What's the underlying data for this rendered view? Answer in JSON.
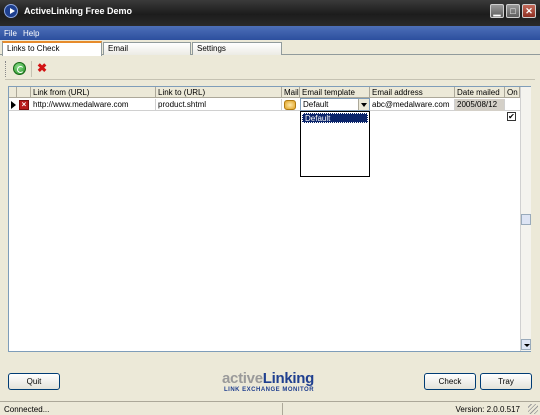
{
  "window": {
    "title": "ActiveLinking Free Demo",
    "minimize": "▁",
    "maximize": "□",
    "close": "✕"
  },
  "menu": {
    "file": "File",
    "help": "Help"
  },
  "tabs": [
    {
      "label": "Links to Check"
    },
    {
      "label": "Email"
    },
    {
      "label": "Settings"
    }
  ],
  "toolbar": {
    "refresh_icon": "refresh-icon",
    "delete_icon": "delete-icon",
    "delete_glyph": "✖"
  },
  "grid": {
    "columns": [
      "Link from (URL)",
      "Link to (URL)",
      "Mail",
      "Email template",
      "Email address",
      "Date mailed",
      "On"
    ],
    "rows": [
      {
        "link_from": "http://www.medalware.com",
        "link_to": "product.shtml",
        "email_template": "Default",
        "email_address": "abc@medalware.com",
        "date_mailed": "2005/08/12",
        "on": true,
        "on_glyph": "✔",
        "status_glyph": "×"
      }
    ],
    "template_options": [
      "Default"
    ]
  },
  "buttons": {
    "quit": "Quit",
    "check": "Check",
    "tray": "Tray"
  },
  "logo": {
    "prefix": "active",
    "suffix": "Linking",
    "tagline": "LINK EXCHANGE MONITOR"
  },
  "status": {
    "left": "Connected...",
    "right": "Version: 2.0.0.517"
  },
  "colors": {
    "menubar": "#2c4f9e",
    "selection": "#0a246a",
    "accent_tab": "#e68b2c",
    "logo_blue": "#1f3f8f"
  }
}
